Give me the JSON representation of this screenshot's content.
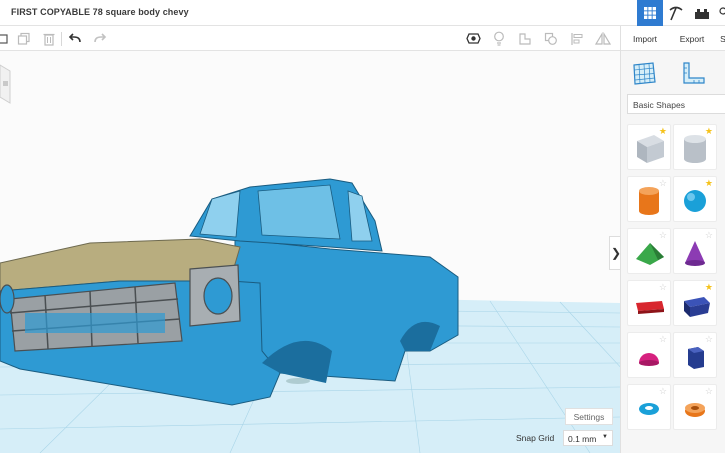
{
  "project": {
    "title": "FIRST COPYABLE 78 square body chevy"
  },
  "top_nav": {
    "icons": [
      "grid-view-icon",
      "pickaxe-icon",
      "bricks-icon",
      "user-icon"
    ]
  },
  "toolbar": {
    "icons": [
      "new-shape-icon",
      "copy-icon",
      "delete-icon",
      "undo-icon",
      "redo-icon",
      "visibility-icon",
      "light-bulb-icon",
      "note-icon",
      "group-icon",
      "align-icon",
      "mirror-icon"
    ]
  },
  "panel": {
    "import_label": "Import",
    "export_label": "Export",
    "send_label": "S",
    "category_label": "Basic Shapes",
    "tools": [
      "workplane-icon",
      "ruler-icon"
    ],
    "shapes": [
      {
        "name": "Box",
        "color": "#bfc7d1",
        "starred": true
      },
      {
        "name": "Cylinder",
        "color": "#bfc7d1",
        "starred": true
      },
      {
        "name": "Cylinder",
        "color": "#e8761a",
        "starred": false
      },
      {
        "name": "Sphere",
        "color": "#1aa0d8",
        "starred": true
      },
      {
        "name": "Roof",
        "color": "#3aa84a",
        "starred": false
      },
      {
        "name": "Cone",
        "color": "#8c3bb3",
        "starred": false
      },
      {
        "name": "Text",
        "color": "#d8262e",
        "starred": false
      },
      {
        "name": "Box",
        "color": "#2a3d94",
        "starred": true
      },
      {
        "name": "Half Sphere",
        "color": "#d6217f",
        "starred": false
      },
      {
        "name": "Polygon",
        "color": "#253c8f",
        "starred": false
      },
      {
        "name": "Torus",
        "color": "#1aa0d8",
        "starred": false
      },
      {
        "name": "Tube",
        "color": "#e8761a",
        "starred": false
      }
    ]
  },
  "viewport": {
    "settings_label": "Settings",
    "snap_grid_label": "Snap Grid",
    "snap_grid_value": "0.1 mm",
    "collapse_glyph": "❯",
    "model_color": "#2e9ad3",
    "hood_color": "#b8ad7f"
  },
  "colors": {
    "accent": "#2f7bd1",
    "star": "#f5c21b"
  }
}
